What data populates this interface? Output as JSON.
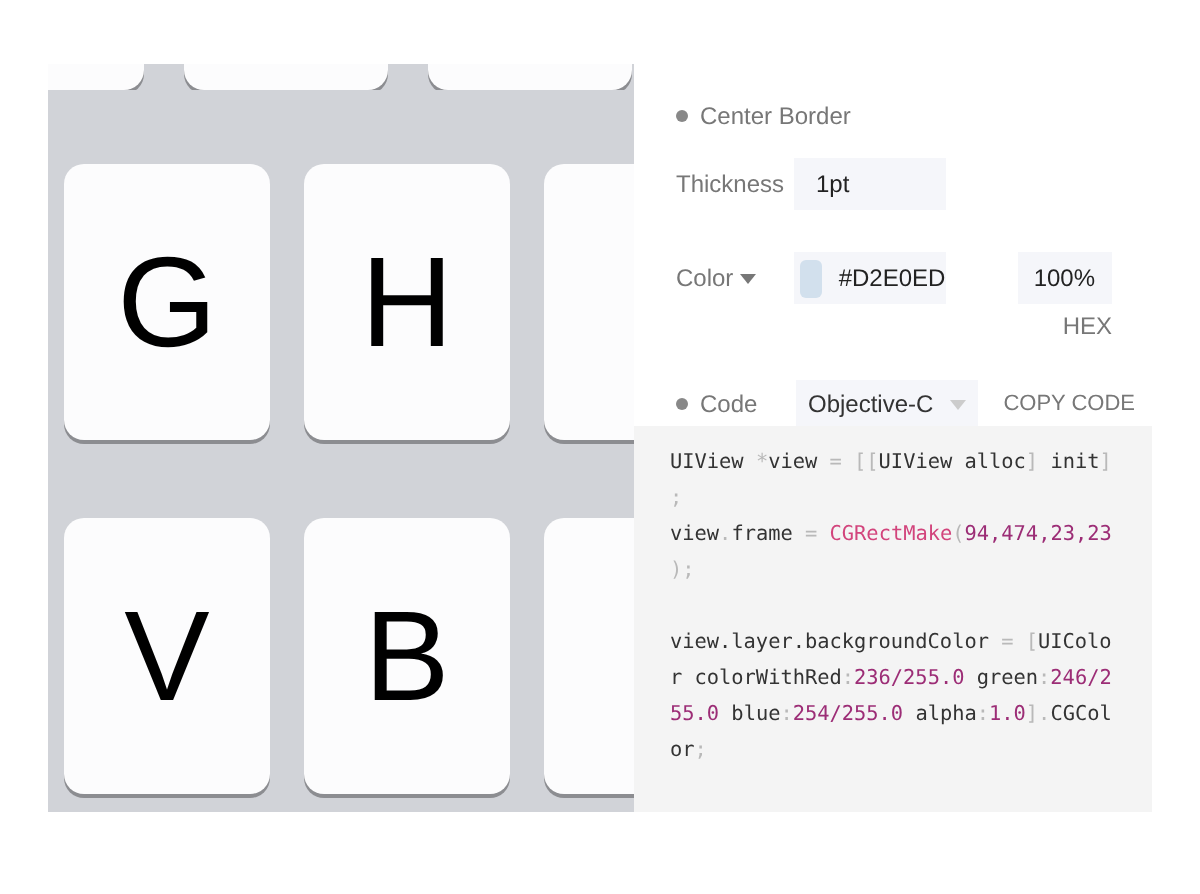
{
  "keyboard": {
    "rows": [
      {
        "keys": [
          "G",
          "H"
        ]
      },
      {
        "keys": [
          "V",
          "B"
        ]
      }
    ]
  },
  "panel": {
    "section_title": "Center Border",
    "thickness": {
      "label": "Thickness",
      "value": "1pt"
    },
    "color": {
      "label": "Color",
      "value": "#D2E0ED",
      "opacity": "100%",
      "format": "HEX"
    },
    "code": {
      "label": "Code",
      "language": "Objective-C",
      "copy_button": "COPY CODE",
      "blocks": [
        [
          [
            {
              "text": "UIView ",
              "kind": "plain"
            },
            {
              "text": "*",
              "kind": "punct"
            },
            {
              "text": "view ",
              "kind": "plain"
            },
            {
              "text": "= [[",
              "kind": "punct"
            },
            {
              "text": "UIView alloc",
              "kind": "plain"
            },
            {
              "text": "] ",
              "kind": "punct"
            },
            {
              "text": "init",
              "kind": "plain"
            },
            {
              "text": "]",
              "kind": "punct"
            }
          ],
          [
            {
              "text": ";",
              "kind": "punct"
            }
          ],
          [
            {
              "text": "view",
              "kind": "plain"
            },
            {
              "text": ".",
              "kind": "punct"
            },
            {
              "text": "frame ",
              "kind": "plain"
            },
            {
              "text": "= ",
              "kind": "punct"
            },
            {
              "text": "CGRectMake",
              "kind": "func"
            },
            {
              "text": "(",
              "kind": "punct"
            },
            {
              "text": "94,474,23,23",
              "kind": "num"
            }
          ],
          [
            {
              "text": ");",
              "kind": "punct"
            }
          ]
        ],
        [
          [
            {
              "text": "view.layer.backgroundColor ",
              "kind": "plain"
            },
            {
              "text": "= [",
              "kind": "punct"
            },
            {
              "text": "UIColo",
              "kind": "plain"
            }
          ],
          [
            {
              "text": "r colorWithRed",
              "kind": "plain"
            },
            {
              "text": ":",
              "kind": "punct"
            },
            {
              "text": "236/255.0",
              "kind": "num"
            },
            {
              "text": " green",
              "kind": "plain"
            },
            {
              "text": ":",
              "kind": "punct"
            },
            {
              "text": "246/2",
              "kind": "num"
            }
          ],
          [
            {
              "text": "55.0",
              "kind": "num"
            },
            {
              "text": " blue",
              "kind": "plain"
            },
            {
              "text": ":",
              "kind": "punct"
            },
            {
              "text": "254/255.0",
              "kind": "num"
            },
            {
              "text": " alpha",
              "kind": "plain"
            },
            {
              "text": ":",
              "kind": "punct"
            },
            {
              "text": "1.0",
              "kind": "num"
            },
            {
              "text": "].",
              "kind": "punct"
            },
            {
              "text": "CGCol",
              "kind": "plain"
            }
          ],
          [
            {
              "text": "or",
              "kind": "plain"
            },
            {
              "text": ";",
              "kind": "punct"
            }
          ]
        ]
      ]
    }
  }
}
